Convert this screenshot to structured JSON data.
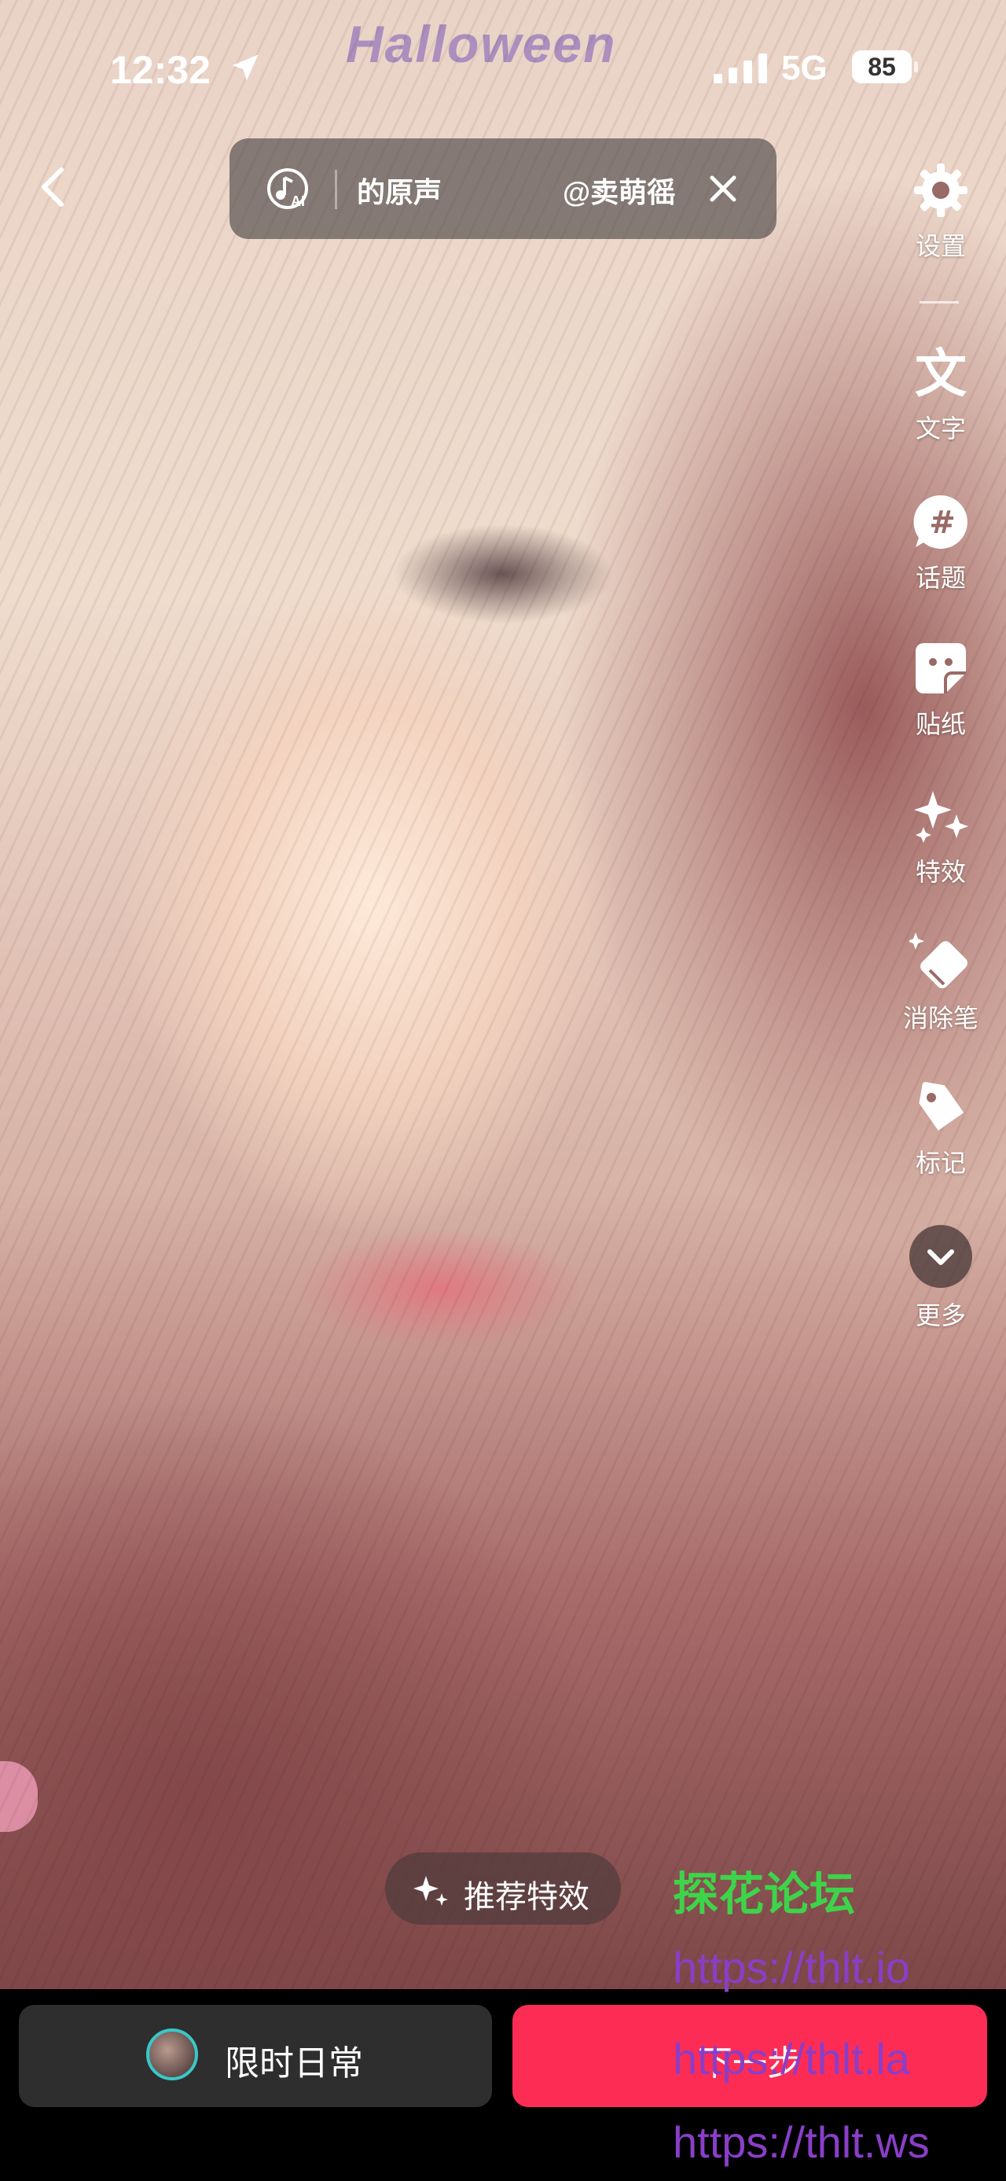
{
  "status_bar": {
    "time": "12:32",
    "network": "5G",
    "battery": "85"
  },
  "overlay_text": "Halloween",
  "music": {
    "title": "的原声",
    "author": "@卖萌徭"
  },
  "tools": [
    {
      "icon": "gear-icon",
      "label": "设置"
    },
    {
      "icon": "text-icon",
      "label": "文字"
    },
    {
      "icon": "hashtag-icon",
      "label": "话题"
    },
    {
      "icon": "sticker-icon",
      "label": "贴纸"
    },
    {
      "icon": "sparkles-icon",
      "label": "特效"
    },
    {
      "icon": "eraser-icon",
      "label": "消除笔"
    },
    {
      "icon": "tag-icon",
      "label": "标记"
    },
    {
      "icon": "chevron-down-icon",
      "label": "更多"
    }
  ],
  "recommend_label": "推荐特效",
  "bottom": {
    "daily_label": "限时日常",
    "next_label": "下一步"
  },
  "watermark": {
    "title": "探花论坛",
    "links": [
      "https://thlt.io",
      "https://thlt.la",
      "https://thlt.ws"
    ]
  }
}
